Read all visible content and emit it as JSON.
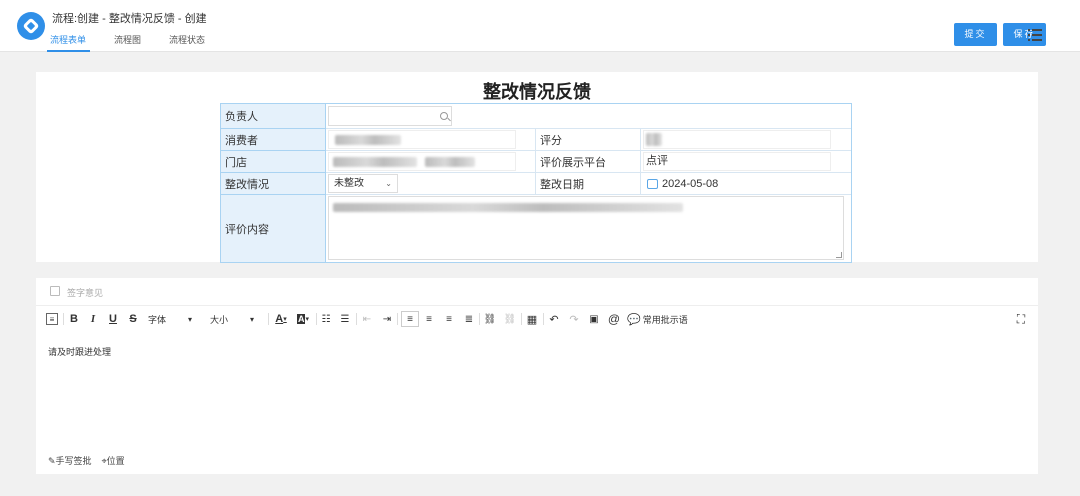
{
  "header": {
    "title": "流程:创建 - 整改情况反馈 - 创建",
    "tabs": [
      "流程表单",
      "流程图",
      "流程状态"
    ],
    "submit_label": "提交",
    "save_label": "保存"
  },
  "form": {
    "title": "整改情况反馈",
    "labels": {
      "owner": "负责人",
      "consumer": "消费者",
      "rating": "评分",
      "store": "门店",
      "platform": "评价展示平台",
      "status": "整改情况",
      "date": "整改日期",
      "content": "评价内容"
    },
    "values": {
      "platform": "点评",
      "status": "未整改",
      "date": "2024-05-08"
    }
  },
  "editor": {
    "sign_opinion": "签字意见",
    "font_label": "字体",
    "size_label": "大小",
    "common_phrases": "常用批示语",
    "content": "请及时跟进处理",
    "handwriting": "手写签批",
    "location": "位置"
  },
  "colors": {
    "accent": "#2f8fe8",
    "label_bg": "#e5f1fb",
    "border": "#a9d3f2"
  }
}
